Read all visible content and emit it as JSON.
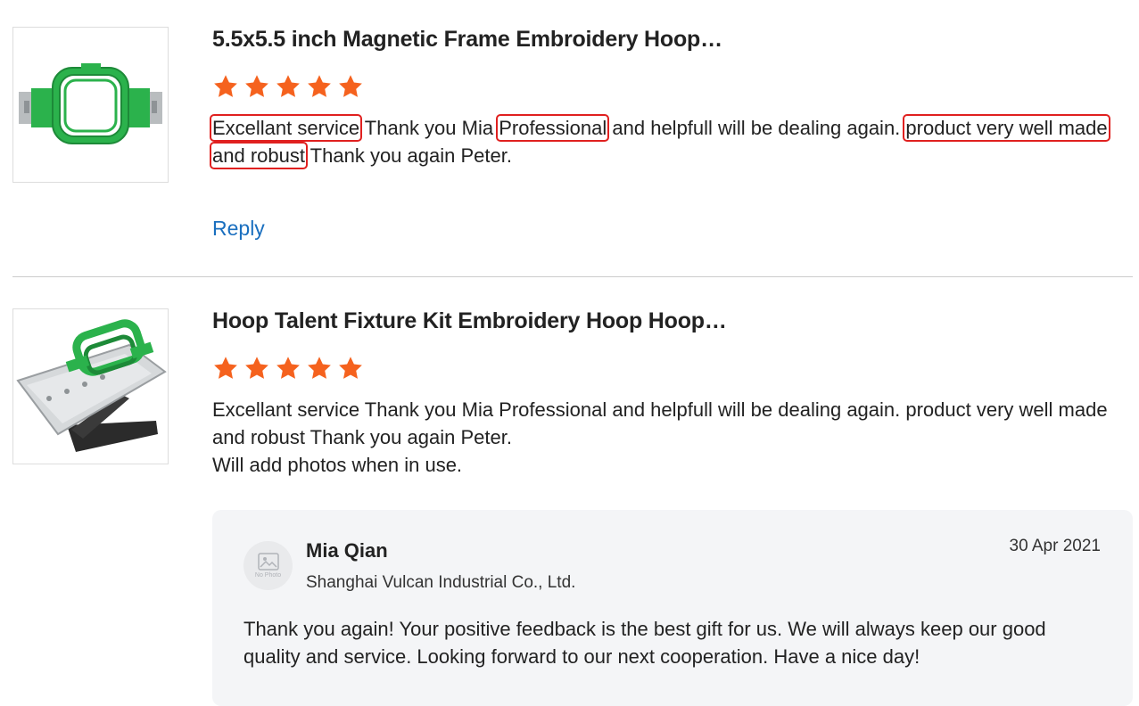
{
  "reviews": [
    {
      "product_title": "5.5x5.5 inch Magnetic Frame Embroidery Hoop…",
      "rating": 5,
      "text_segments": [
        {
          "text": "Excellant service",
          "highlighted": true
        },
        {
          "text": " Thank you Mia ",
          "highlighted": false
        },
        {
          "text": "Professional",
          "highlighted": true
        },
        {
          "text": " and helpfull will be dealing again. ",
          "highlighted": false
        },
        {
          "text": "product very well made and robust",
          "highlighted": true
        },
        {
          "text": " Thank you again Peter.",
          "highlighted": false
        }
      ],
      "reply_label": "Reply"
    },
    {
      "product_title": "Hoop Talent Fixture Kit Embroidery Hoop Hoop…",
      "rating": 5,
      "text_line_1": "Excellant service Thank you Mia Professional and helpfull will be dealing again. product very well made and robust Thank you again Peter.",
      "text_line_2": "Will add photos when in use.",
      "seller_reply": {
        "avatar_label": "No Photo",
        "name": "Mia Qian",
        "company": "Shanghai Vulcan Industrial Co., Ltd.",
        "date": "30 Apr 2021",
        "text": "Thank you again! Your positive feedback is the best gift for us. We will always keep our good quality and service. Looking forward to our next cooperation. Have a nice day!"
      }
    }
  ],
  "colors": {
    "star": "#f5621e",
    "highlight_box": "#e0201f",
    "link": "#1a6fbf",
    "product_green": "#2bb24c"
  },
  "icons": {
    "star": "star-icon",
    "avatar_placeholder": "image-placeholder-icon"
  }
}
